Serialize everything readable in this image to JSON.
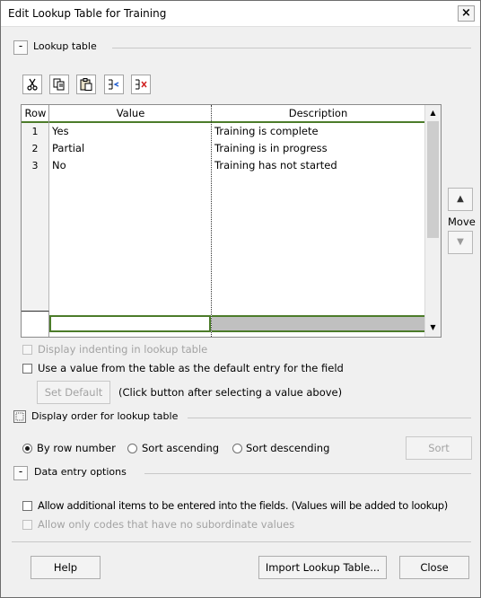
{
  "window": {
    "title": "Edit Lookup Table for Training",
    "close_glyph": "×"
  },
  "lookup_section": {
    "toggle": "-",
    "label": "Lookup table"
  },
  "toolbar": {
    "icons": [
      "cut-icon",
      "copy-icon",
      "paste-icon",
      "insert-row-icon",
      "delete-row-icon"
    ]
  },
  "grid": {
    "columns": [
      "Row",
      "Value",
      "Description"
    ],
    "rows": [
      {
        "row": "1",
        "value": "Yes",
        "description": "Training is complete"
      },
      {
        "row": "2",
        "value": "Partial",
        "description": "Training is in progress"
      },
      {
        "row": "3",
        "value": "No",
        "description": "Training has not started"
      },
      {
        "row": "",
        "value": "",
        "description": ""
      },
      {
        "row": "",
        "value": "",
        "description": ""
      },
      {
        "row": "",
        "value": "",
        "description": ""
      },
      {
        "row": "",
        "value": "",
        "description": ""
      },
      {
        "row": "",
        "value": "",
        "description": ""
      },
      {
        "row": "",
        "value": "",
        "description": ""
      },
      {
        "row": "",
        "value": "",
        "description": ""
      },
      {
        "row": "",
        "value": "",
        "description": ""
      },
      {
        "row": "",
        "value": "",
        "description": ""
      }
    ]
  },
  "move": {
    "label": "Move",
    "up": "▲",
    "down": "▼"
  },
  "options": {
    "display_indenting": "Display indenting in lookup table",
    "use_default": "Use a value from the table as the default entry for the field",
    "set_default_button": "Set Default",
    "set_default_hint": "(Click button after selecting a value above)"
  },
  "display_order_section": {
    "label": "Display order for lookup table"
  },
  "sort_options": {
    "by_row": "By row number",
    "ascending": "Sort ascending",
    "descending": "Sort descending",
    "selected": "By row number",
    "sort_button": "Sort"
  },
  "data_entry_section": {
    "toggle": "-",
    "label": "Data entry options"
  },
  "data_entry": {
    "allow_additional": "Allow additional items to be entered into the fields. (Values will be added to lookup)",
    "allow_only_codes": "Allow only codes that have no subordinate values"
  },
  "footer": {
    "help": "Help",
    "import": "Import Lookup Table...",
    "close": "Close"
  },
  "colors": {
    "grid_header_rule": "#4c7c2a",
    "selected_cell": "#c0c0c0"
  }
}
